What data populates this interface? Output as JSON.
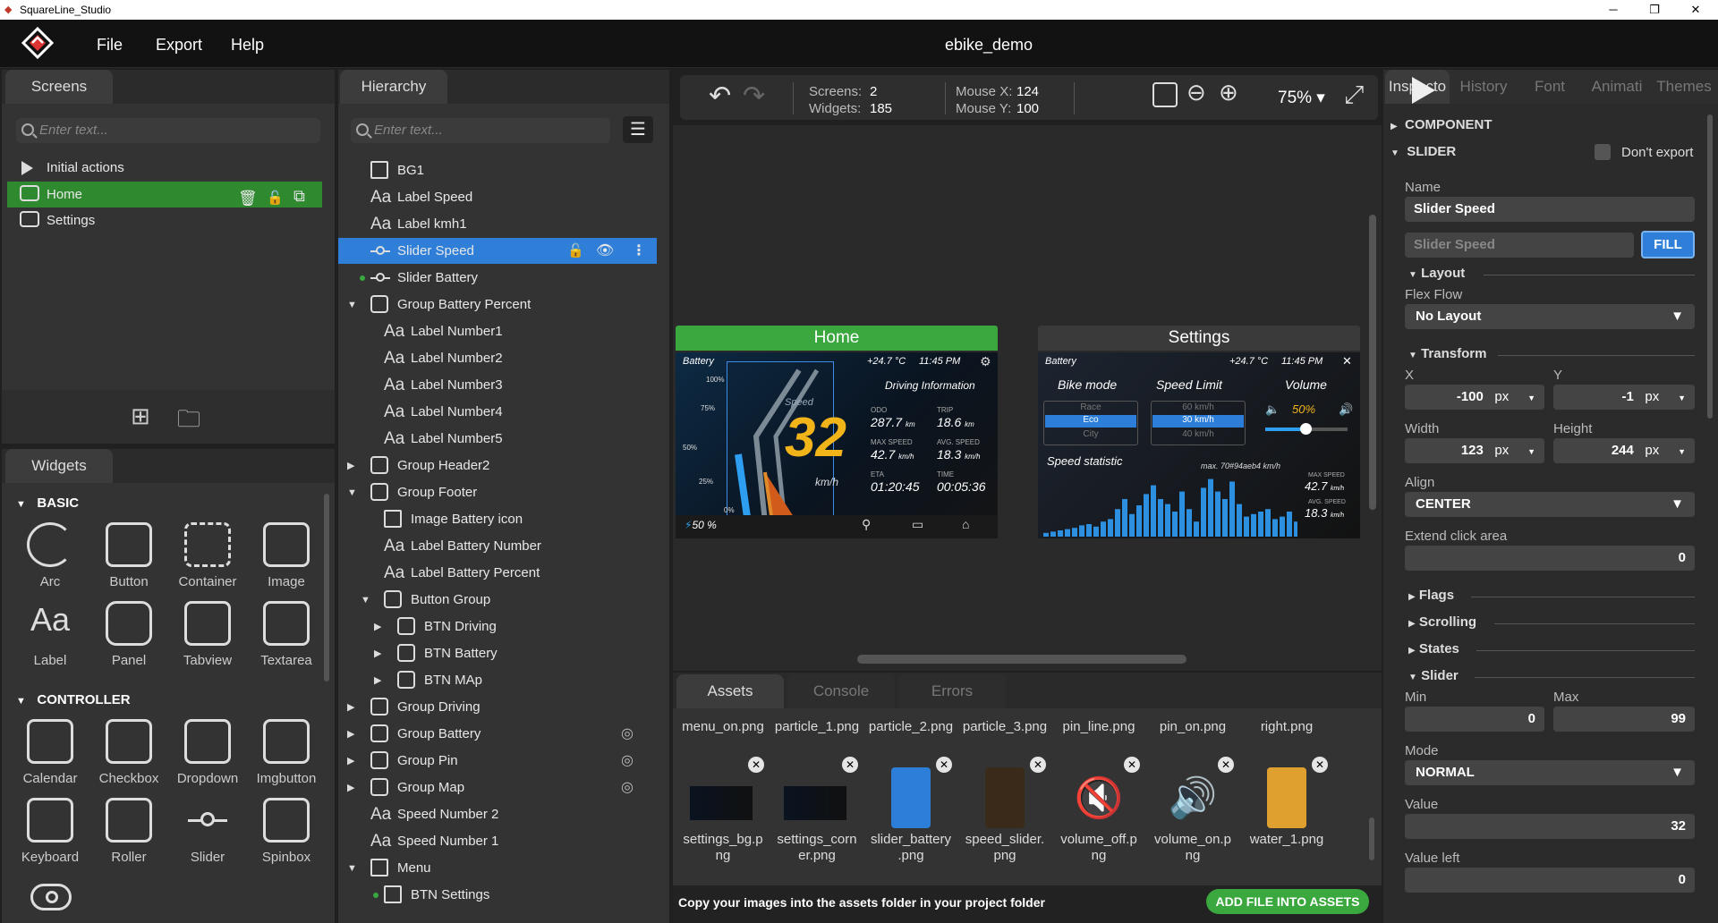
{
  "window": {
    "title": "SquareLine_Studio",
    "minimize": "─",
    "maximize": "❐",
    "close": "✕"
  },
  "menu": {
    "file": "File",
    "export": "Export",
    "help": "Help",
    "project": "ebike_demo"
  },
  "screens_panel": {
    "tab": "Screens",
    "search_placeholder": "Enter text...",
    "items": [
      {
        "label": "Initial actions"
      },
      {
        "label": "Home"
      },
      {
        "label": "Settings"
      }
    ]
  },
  "hierarchy_panel": {
    "tab": "Hierarchy",
    "search_placeholder": "Enter text...",
    "items": [
      {
        "label": "BG1"
      },
      {
        "label": "Label Speed"
      },
      {
        "label": "Label kmh1"
      },
      {
        "label": "Slider Speed"
      },
      {
        "label": "Slider Battery"
      },
      {
        "label": "Group Battery Percent"
      },
      {
        "label": "Label Number1"
      },
      {
        "label": "Label Number2"
      },
      {
        "label": "Label Number3"
      },
      {
        "label": "Label Number4"
      },
      {
        "label": "Label Number5"
      },
      {
        "label": "Group Header2"
      },
      {
        "label": "Group Footer"
      },
      {
        "label": "Image Battery icon"
      },
      {
        "label": "Label Battery Number"
      },
      {
        "label": "Label Battery Percent"
      },
      {
        "label": "Button Group"
      },
      {
        "label": "BTN Driving"
      },
      {
        "label": "BTN Battery"
      },
      {
        "label": "BTN MAp"
      },
      {
        "label": "Group Driving"
      },
      {
        "label": "Group Battery"
      },
      {
        "label": "Group Pin"
      },
      {
        "label": "Group Map"
      },
      {
        "label": "Speed Number 2"
      },
      {
        "label": "Speed Number 1"
      },
      {
        "label": "Menu"
      },
      {
        "label": "BTN Settings"
      }
    ]
  },
  "widgets_panel": {
    "tab": "Widgets",
    "basic_title": "BASIC",
    "basic": [
      "Arc",
      "Button",
      "Container",
      "Image",
      "Label",
      "Panel",
      "Tabview",
      "Textarea"
    ],
    "controller_title": "CONTROLLER",
    "controller": [
      "Calendar",
      "Checkbox",
      "Dropdown",
      "Imgbutton",
      "Keyboard",
      "Roller",
      "Slider",
      "Spinbox"
    ]
  },
  "toolbar": {
    "screens_label": "Screens:",
    "screens_value": "2",
    "widgets_label": "Widgets:",
    "widgets_value": "185",
    "mouse_x_label": "Mouse X:",
    "mouse_x_value": "124",
    "mouse_y_label": "Mouse Y:",
    "mouse_y_value": "100",
    "zoom": "75%"
  },
  "canvas": {
    "home": {
      "title": "Home",
      "battery": "Battery",
      "temp": "+24.7",
      "temp_unit": "°C",
      "time": "11:45",
      "time_suffix": "PM",
      "speed_label": "Speed",
      "speed": "32",
      "speed_unit": "km/h",
      "info_title": "Driving Information",
      "odo_label": "ODO",
      "odo": "287.7",
      "odo_unit": "km",
      "trip_label": "TRIP",
      "trip": "18.6",
      "trip_unit": "km",
      "max_label": "MAX SPEED",
      "max": "42.7",
      "max_unit": "km/h",
      "avg_label": "AVG. SPEED",
      "avg": "18.3",
      "avg_unit": "km/h",
      "eta_label": "ETA",
      "eta": "01:20:45",
      "time_label": "TIME",
      "time_val": "00:05:36",
      "ticks": [
        "100%",
        "75%",
        "50%",
        "25%",
        "0%"
      ],
      "battery_pct": "50 %"
    },
    "settings": {
      "title": "Settings",
      "battery": "Battery",
      "temp": "+24.7",
      "temp_unit": "°C",
      "time": "11:45",
      "time_suffix": "PM",
      "bike_mode": "Bike mode",
      "modes": [
        "Race",
        "Eco",
        "City"
      ],
      "speed_limit": "Speed Limit",
      "limits": [
        "60 km/h",
        "30 km/h",
        "40 km/h"
      ],
      "volume": "Volume",
      "volume_val": "50%",
      "stat_title": "Speed statistic",
      "stat_max": "max. 70#94aeb4 km/h",
      "max_label": "MAX SPEED",
      "max": "42.7",
      "max_unit": "km/h",
      "avg_label": "AVG. SPEED",
      "avg": "18.3",
      "avg_unit": "km/h",
      "bars": [
        3,
        4,
        5,
        6,
        7,
        9,
        10,
        8,
        12,
        14,
        22,
        30,
        18,
        25,
        34,
        41,
        30,
        26,
        20,
        36,
        22,
        12,
        39,
        46,
        36,
        30,
        44,
        26,
        16,
        18,
        20,
        22,
        14,
        16,
        20,
        12
      ]
    }
  },
  "assets_panel": {
    "tabs": [
      "Assets",
      "Console",
      "Errors"
    ],
    "top_row": [
      "menu_on.png",
      "particle_1.png",
      "particle_2.png",
      "particle_3.png",
      "pin_line.png",
      "pin_on.png",
      "right.png"
    ],
    "items": [
      {
        "name": "settings_bg.p\nng"
      },
      {
        "name": "settings_corn\ner.png"
      },
      {
        "name": "slider_battery\n.png"
      },
      {
        "name": "speed_slider.\npng"
      },
      {
        "name": "volume_off.p\nng"
      },
      {
        "name": "volume_on.p\nng"
      },
      {
        "name": "water_1.png"
      }
    ],
    "hint": "Copy your images into the assets folder in your project folder",
    "add_button": "ADD FILE INTO ASSETS"
  },
  "inspector": {
    "tabs": [
      "Inspecto",
      "History",
      "Font",
      "Animati",
      "Themes"
    ],
    "component": "COMPONENT",
    "slider_title": "SLIDER",
    "dont_export": "Don't export",
    "name_label": "Name",
    "name_value": "Slider Speed",
    "name_placeholder": "Slider Speed",
    "fill": "FILL",
    "layout": "Layout",
    "flex_flow": "Flex Flow",
    "flex_value": "No Layout",
    "transform": "Transform",
    "x_label": "X",
    "x_value": "-100",
    "y_label": "Y",
    "y_value": "-1",
    "unit": "px",
    "width_label": "Width",
    "width_value": "123",
    "height_label": "Height",
    "height_value": "244",
    "align_label": "Align",
    "align_value": "CENTER",
    "extend_label": "Extend click area",
    "extend_value": "0",
    "flags": "Flags",
    "scrolling": "Scrolling",
    "states": "States",
    "slider": "Slider",
    "min_label": "Min",
    "min_value": "0",
    "max_label": "Max",
    "max_value": "99",
    "mode_label": "Mode",
    "mode_value": "NORMAL",
    "value_label": "Value",
    "value_value": "32",
    "value_left_label": "Value left",
    "value_left_value": "0"
  },
  "colors": {
    "accent": "#2f7fd8",
    "green": "#3aa83e",
    "selected_screen": "#2f8a2f"
  }
}
